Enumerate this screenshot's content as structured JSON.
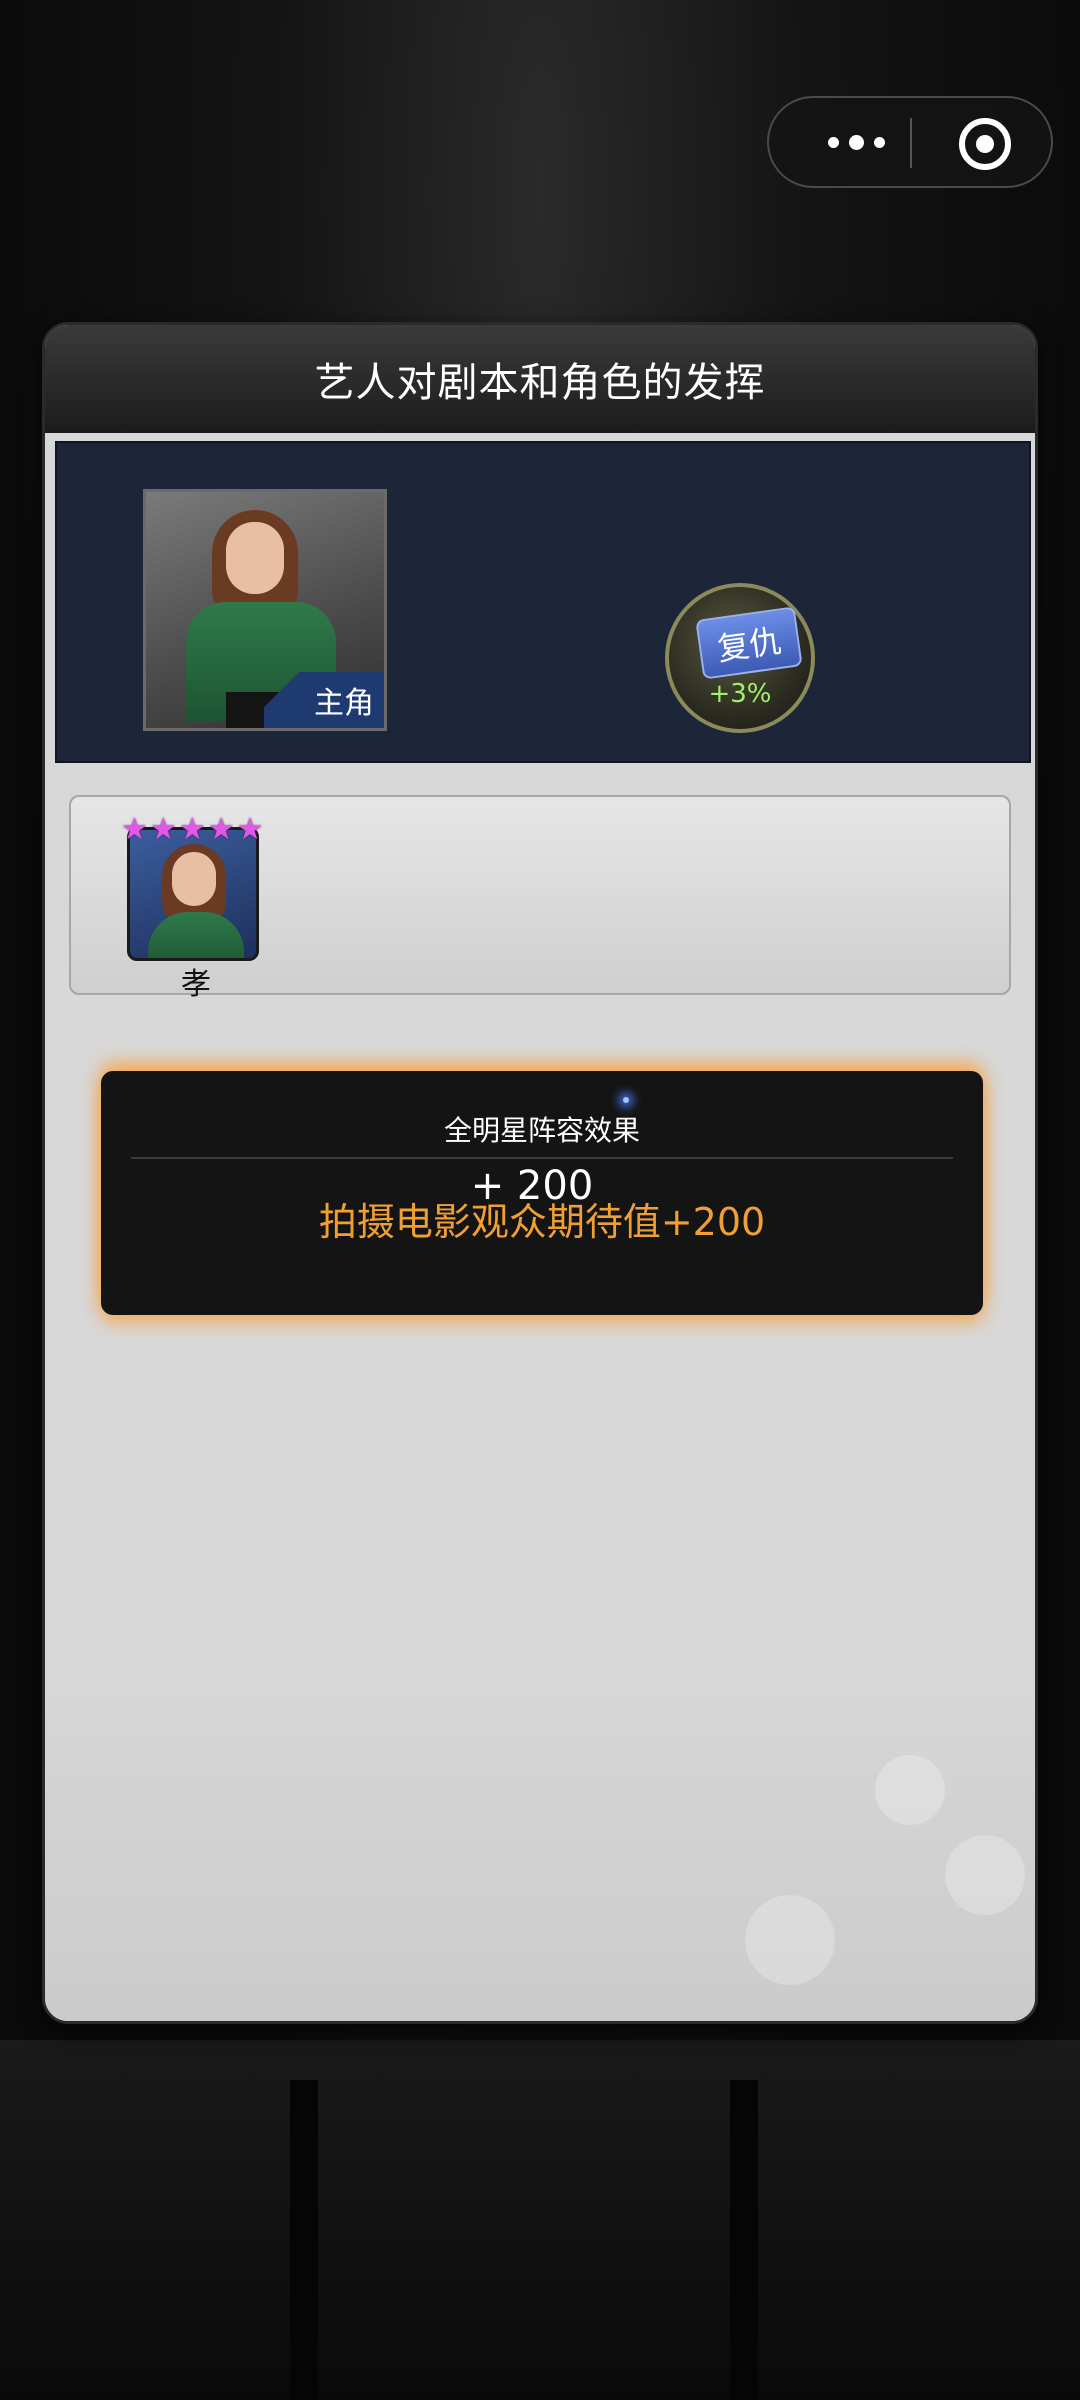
{
  "menu_capsule": {
    "more_icon": "more-dots-icon",
    "close_icon": "target-circle-icon"
  },
  "panel": {
    "title": "艺人对剧本和角色的发挥",
    "lead": {
      "badge": "主角"
    },
    "skill": {
      "name": "复仇",
      "bonus": "+3%"
    },
    "cast": [
      {
        "name": "孝",
        "stars": 5
      }
    ],
    "all_star": {
      "title": "全明星阵容效果",
      "value": "+ 200",
      "description": "拍摄电影观众期待值+200"
    }
  },
  "colors": {
    "panel_bg": "#d8d8d8",
    "lead_bg": "#1c2638",
    "effect_text": "#f0a033",
    "star": "#e058e6",
    "skill_bonus": "#9ff26a"
  }
}
